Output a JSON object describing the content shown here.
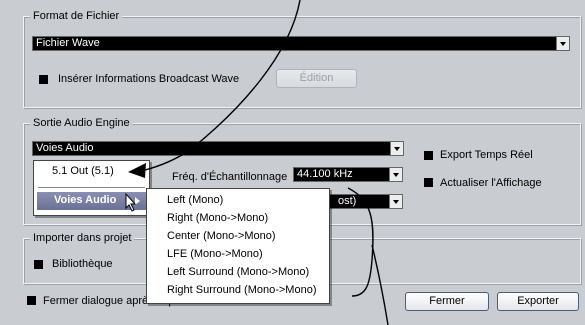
{
  "format": {
    "title": "Format de Fichier",
    "type_value": "Fichier Wave",
    "bwf_label": "Insérer Informations Broadcast Wave",
    "edit_button": "Édition"
  },
  "engine": {
    "title": "Sortie Audio Engine",
    "channel_value": "Voies Audio",
    "realtime_label": "Export Temps Réel",
    "refresh_label": "Actualiser l'Affichage",
    "samplerate_label": "Fréq. d'Échantillonnage",
    "samplerate_value": "44.100 kHz",
    "bitdepth_value_partial": "ost)"
  },
  "import": {
    "title": "Importer dans projet",
    "library_label": "Bibliothèque"
  },
  "footer": {
    "close_label": "Fermer dialogue après export",
    "close_button": "Fermer",
    "export_button": "Exporter"
  },
  "output_popup": {
    "output_item": "5.1 Out (5.1)",
    "channels_item": "Voies Audio"
  },
  "channels_submenu": [
    "Left (Mono)",
    "Right (Mono->Mono)",
    "Center (Mono->Mono)",
    "LFE (Mono->Mono)",
    "Left Surround (Mono->Mono)",
    "Right Surround (Mono->Mono)"
  ]
}
